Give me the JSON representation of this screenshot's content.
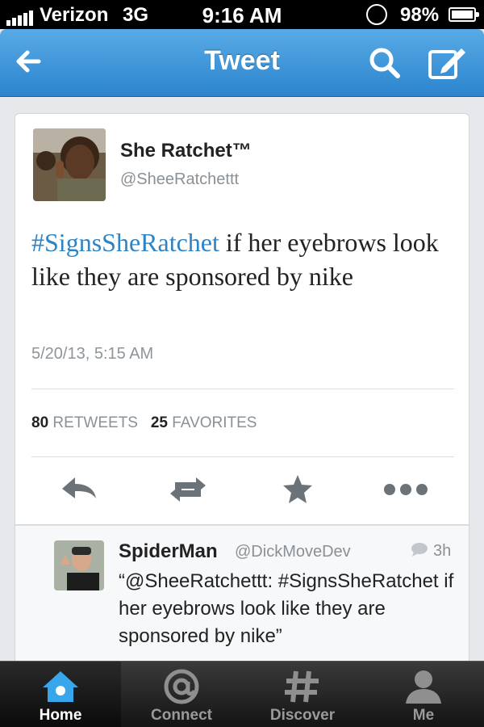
{
  "status_bar": {
    "carrier": "Verizon",
    "network": "3G",
    "time": "9:16 AM",
    "battery": "98%"
  },
  "nav": {
    "title": "Tweet",
    "back_icon": "back-arrow-icon",
    "search_icon": "search-icon",
    "compose_icon": "compose-icon",
    "color": "#3592d6"
  },
  "tweet": {
    "author_name": "She Ratchet™",
    "author_handle": "@SheeRatchettt",
    "hashtag": "#SignsSheRatchet",
    "text": " if her eyebrows look like they are sponsored by nike",
    "date": "5/20/13, 5:15 AM",
    "retweets_count": "80",
    "retweets_label": "RETWEETS",
    "favorites_count": "25",
    "favorites_label": "FAVORITES",
    "hashtag_color": "#2c83c6"
  },
  "actions": [
    {
      "name": "reply",
      "icon": "reply-icon"
    },
    {
      "name": "retweet",
      "icon": "retweet-icon"
    },
    {
      "name": "favorite",
      "icon": "star-icon"
    },
    {
      "name": "more",
      "icon": "more-icon"
    }
  ],
  "reply": {
    "name": "SpiderMan",
    "handle": "@DickMoveDev",
    "time": "3h",
    "text": "“@SheeRatchettt: #SignsSheRatchet if her eyebrows look like they are sponsored by nike”"
  },
  "tabs": [
    {
      "label": "Home",
      "icon": "home-icon",
      "active": true
    },
    {
      "label": "Connect",
      "icon": "at-icon",
      "active": false
    },
    {
      "label": "Discover",
      "icon": "hash-icon",
      "active": false
    },
    {
      "label": "Me",
      "icon": "person-icon",
      "active": false
    }
  ]
}
